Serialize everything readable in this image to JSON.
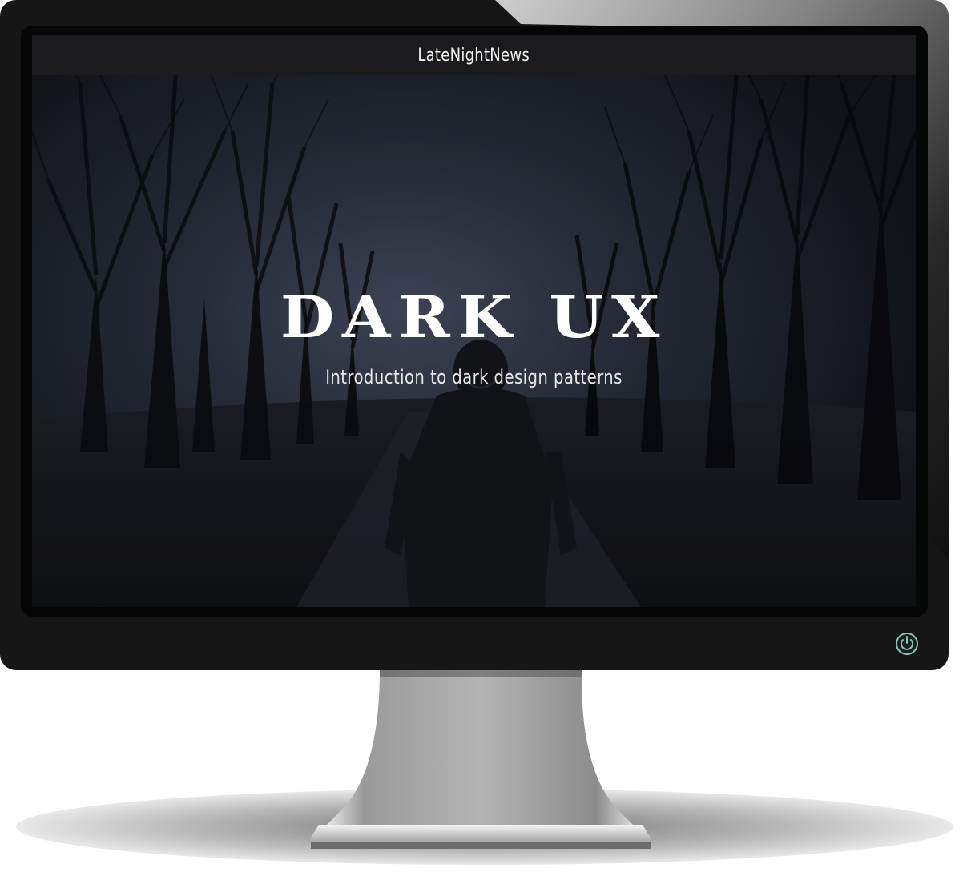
{
  "site": {
    "brand": "LateNightNews"
  },
  "hero": {
    "title": "DARK UX",
    "subtitle": "Introduction to dark design patterns"
  },
  "device": {
    "power_icon": "power-icon",
    "power_color": "#7fc7b6"
  }
}
